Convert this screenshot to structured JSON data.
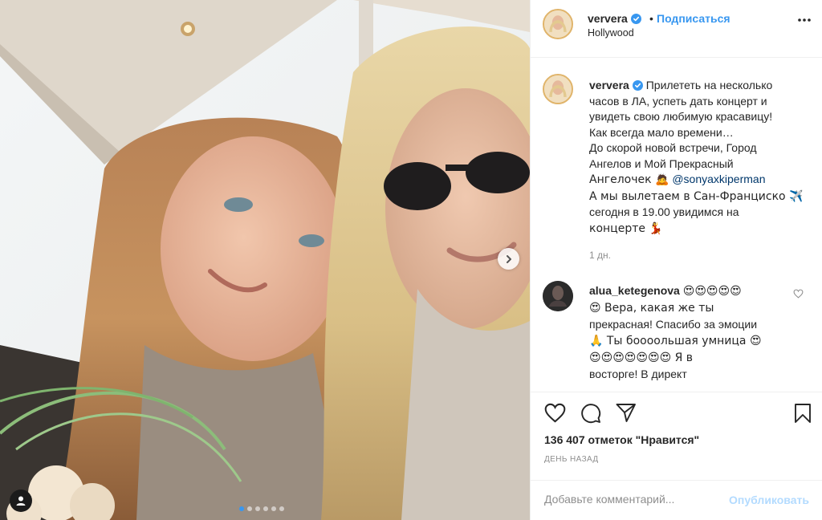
{
  "post": {
    "username": "ververa",
    "follow_label": "Подписаться",
    "separator": "•",
    "location": "Hollywood",
    "caption_lines": [
      "Прилететь на несколько",
      "часов в ЛА, успеть дать концерт и",
      "увидеть свою любимую красавицу!",
      "Как всегда мало времени…",
      "До скорой новой встречи, Город",
      "Ангелов и Мой Прекрасный",
      "Ангелочек 🙇",
      "А мы вылетаем в Сан-Франциско ✈️",
      "сегодня в 19.00 увидимся на",
      "концерте 💃"
    ],
    "mention": "@sonyaxkiperman",
    "time_ago": "1 дн.",
    "likes": "136 407 отметок \"Нравится\"",
    "date": "ДЕНЬ НАЗАД"
  },
  "comment": {
    "username": "alua_ketegenova",
    "text_lines": [
      "😍😍😍😍😍",
      "😍 Вера, какая же ты",
      "прекрасная! Спасибо за эмоции",
      "🙏 Ты боооольшая умница 😍",
      "😍😍😍😍😍😍😍 Я в",
      "восторге! В директ"
    ]
  },
  "comment_form": {
    "placeholder": "Добавьте комментарий...",
    "publish_label": "Опубликовать"
  },
  "carousel": {
    "total": 6,
    "active_index": 0
  },
  "colors": {
    "accent": "#3897f0",
    "text": "#262626",
    "muted": "#8e8e8e",
    "publish_disabled": "#b3dbff"
  },
  "icons": [
    "verified-badge-icon",
    "more-options-icon",
    "next-arrow-icon",
    "user-tag-icon",
    "like-heart-icon",
    "comment-icon",
    "share-icon",
    "save-bookmark-icon",
    "comment-like-icon"
  ]
}
